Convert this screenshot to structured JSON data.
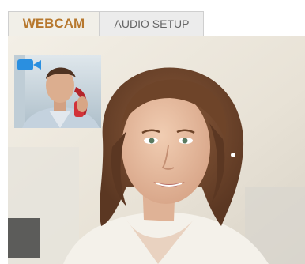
{
  "tabs": [
    {
      "label": "WEBCAM",
      "active": true
    },
    {
      "label": "AUDIO SETUP",
      "active": false
    }
  ],
  "colors": {
    "active_tab_text": "#b7782e",
    "inactive_tab_text": "#666666",
    "camera_icon": "#2a8fe0"
  },
  "icons": {
    "camera": "video-camera-icon"
  }
}
